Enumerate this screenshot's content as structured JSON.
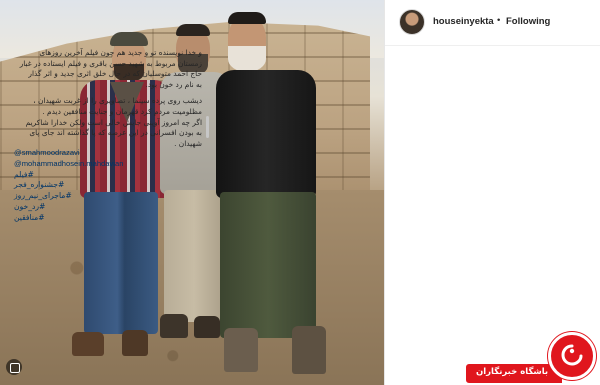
{
  "post": {
    "username": "houseinyekta",
    "separator": "•",
    "follow_status": "Following"
  },
  "caption": {
    "lines": [
      "و خدا نویسنده تو و جدید هم چون فیلم آخرین روزهای",
      "زمستان مربوط به شهید حسن باقری و فیلم ایستاده در غبار",
      "حاج احمد متوسلیان که در حال خلق اثری جدید و اثر گذار",
      "به نام رد خون بود.",
      "",
      "دیشب روی پرده سینما ، تصاویری را از غربت شهیدان ،",
      "مظلومیت مردم کرد قهرمان و جنایت منافقین دیدم .",
      "اگر چه امروز آوینی جایش خالی است ولکن خدارا شاکریم",
      "به بودن افسرانی در این عرصه که پا گذاشته اند جای پای",
      "شهیدان ."
    ],
    "mentions": [
      "@smahmoodrazavi",
      "@mohammadhosein.mahdavian"
    ],
    "hashtags": [
      "#فیلم",
      "#جشنواره_فجر",
      "#ماجرای_نیم_روز",
      "#رد_خون",
      "#منافقین"
    ]
  },
  "watermark": {
    "label": "باشگاه خبرنگاران"
  },
  "colors": {
    "link": "#003569",
    "brand_red": "#e0161d"
  },
  "icons": [
    "avatar",
    "gallery-icon",
    "brand-logo-icon"
  ]
}
